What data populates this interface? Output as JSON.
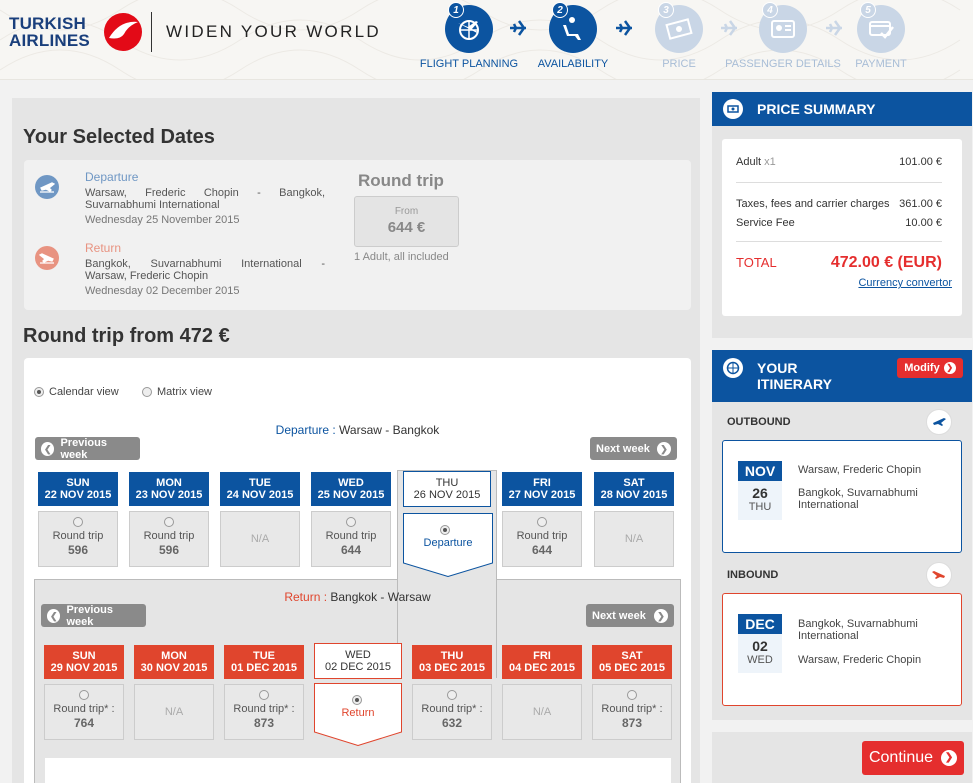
{
  "header": {
    "brand_line1": "TURKISH",
    "brand_line2": "AIRLINES",
    "slogan": "WIDEN YOUR WORLD",
    "steps": [
      {
        "num": "1",
        "label": "FLIGHT PLANNING",
        "active": true
      },
      {
        "num": "2",
        "label": "AVAILABILITY",
        "active": true
      },
      {
        "num": "3",
        "label": "PRICE",
        "active": false
      },
      {
        "num": "4",
        "label": "PASSENGER DETAILS",
        "active": false
      },
      {
        "num": "5",
        "label": "PAYMENT",
        "active": false
      }
    ]
  },
  "selected_dates": {
    "title": "Your Selected Dates",
    "departure": {
      "label": "Departure",
      "route_line1": "Warsaw, Frederic Chopin - Bangkok,",
      "route_line2": "Suvarnabhumi International",
      "date": "Wednesday 25 November 2015"
    },
    "return": {
      "label": "Return",
      "route_line1": "Bangkok, Suvarnabhumi International -",
      "route_line2": "Warsaw, Frederic Chopin",
      "date": "Wednesday 02 December 2015"
    },
    "trip_type": "Round trip",
    "from_label": "From",
    "from_price": "644 €",
    "pax_note": "1 Adult, all included"
  },
  "calendar": {
    "title": "Round trip from 472 €",
    "view_calendar": "Calendar view",
    "view_matrix": "Matrix view",
    "prev_week": "Previous week",
    "next_week": "Next week",
    "departure_prefix": "Departure :",
    "departure_route": "Warsaw - Bangkok",
    "return_prefix": "Return :",
    "return_route": "Bangkok - Warsaw",
    "departure_days": [
      {
        "day": "SUN",
        "date": "22 NOV 2015",
        "label": "Round trip",
        "price": "596"
      },
      {
        "day": "MON",
        "date": "23 NOV 2015",
        "label": "Round trip",
        "price": "596"
      },
      {
        "day": "TUE",
        "date": "24 NOV 2015",
        "na": "N/A"
      },
      {
        "day": "WED",
        "date": "25 NOV 2015",
        "label": "Round trip",
        "price": "644"
      },
      {
        "day": "THU",
        "date": "26 NOV 2015",
        "selected": "Departure"
      },
      {
        "day": "FRI",
        "date": "27 NOV 2015",
        "label": "Round trip",
        "price": "644"
      },
      {
        "day": "SAT",
        "date": "28 NOV 2015",
        "na": "N/A"
      }
    ],
    "return_days": [
      {
        "day": "SUN",
        "date": "29 NOV 2015",
        "label": "Round trip* :",
        "price": "764"
      },
      {
        "day": "MON",
        "date": "30 NOV 2015",
        "na": "N/A"
      },
      {
        "day": "TUE",
        "date": "01 DEC 2015",
        "label": "Round trip* :",
        "price": "873"
      },
      {
        "day": "WED",
        "date": "02 DEC 2015",
        "selected": "Return"
      },
      {
        "day": "THU",
        "date": "03 DEC 2015",
        "label": "Round trip* :",
        "price": "632"
      },
      {
        "day": "FRI",
        "date": "04 DEC 2015",
        "na": "N/A"
      },
      {
        "day": "SAT",
        "date": "05 DEC 2015",
        "label": "Round trip* :",
        "price": "873"
      }
    ]
  },
  "price_summary": {
    "title": "PRICE SUMMARY",
    "adult_label": "Adult",
    "adult_count": "x1",
    "adult_price": "101.00 €",
    "taxes_label": "Taxes, fees and carrier charges",
    "taxes_price": "361.00 €",
    "service_label": "Service Fee",
    "service_price": "10.00 €",
    "total_label": "TOTAL",
    "total_price": "472.00 € (EUR)",
    "currency_link": "Currency convertor"
  },
  "itinerary": {
    "title_line1": "YOUR",
    "title_line2": "ITINERARY",
    "modify": "Modify",
    "outbound_label": "OUTBOUND",
    "outbound": {
      "month": "NOV",
      "day": "26",
      "weekday": "THU",
      "from": "Warsaw, Frederic Chopin",
      "to_line1": "Bangkok, Suvarnabhumi",
      "to_line2": "International"
    },
    "inbound_label": "INBOUND",
    "inbound": {
      "month": "DEC",
      "day": "02",
      "weekday": "WED",
      "from_line1": "Bangkok, Suvarnabhumi",
      "from_line2": "International",
      "to": "Warsaw, Frederic Chopin"
    }
  },
  "continue_label": "Continue",
  "colors": {
    "brand_blue": "#0c54a0",
    "brand_red": "#e0452d",
    "cta_red": "#e52e2e"
  }
}
